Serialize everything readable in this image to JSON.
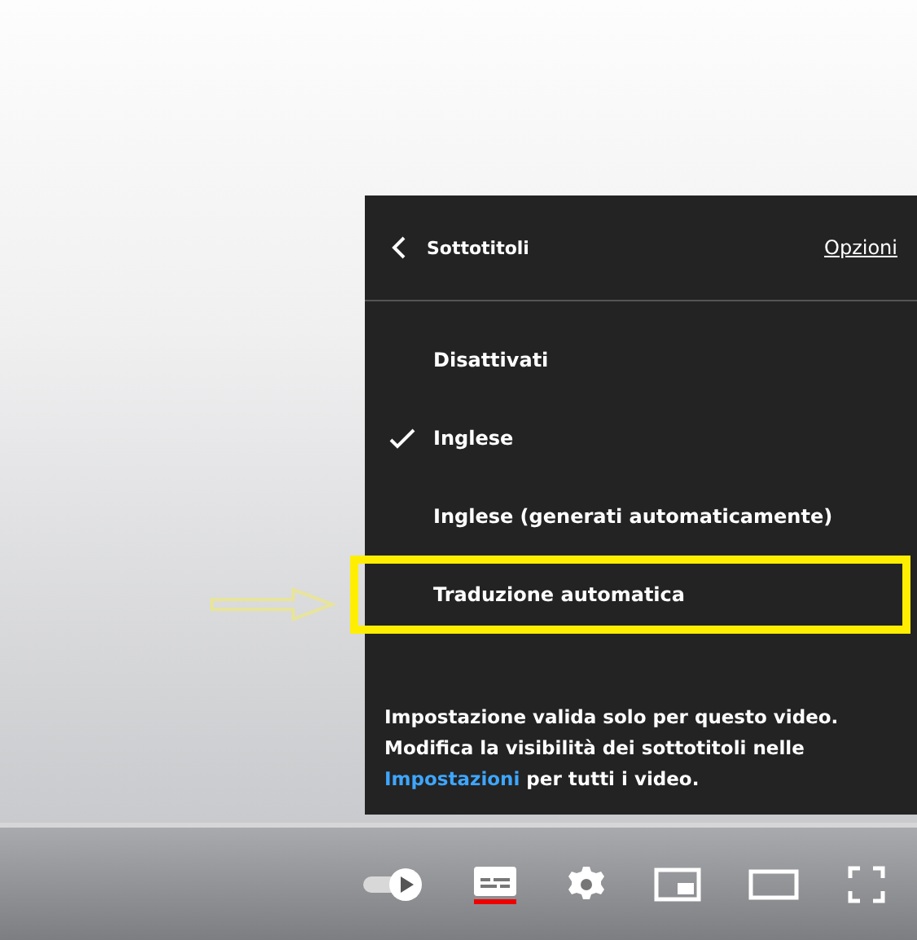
{
  "menu": {
    "title": "Sottotitoli",
    "options_link": "Opzioni",
    "items": [
      {
        "label": "Disattivati",
        "selected": false,
        "highlighted": false
      },
      {
        "label": "Inglese",
        "selected": true,
        "highlighted": false
      },
      {
        "label": "Inglese (generati automaticamente)",
        "selected": false,
        "highlighted": false
      },
      {
        "label": "Traduzione automatica",
        "selected": false,
        "highlighted": true
      }
    ],
    "note": {
      "before": "Impostazione valida solo per questo video. Modifica la visibilità dei sottotitoli nelle ",
      "link": "Impostazioni",
      "after": " per tutti i video."
    }
  },
  "controls": {
    "captions_on": true
  }
}
